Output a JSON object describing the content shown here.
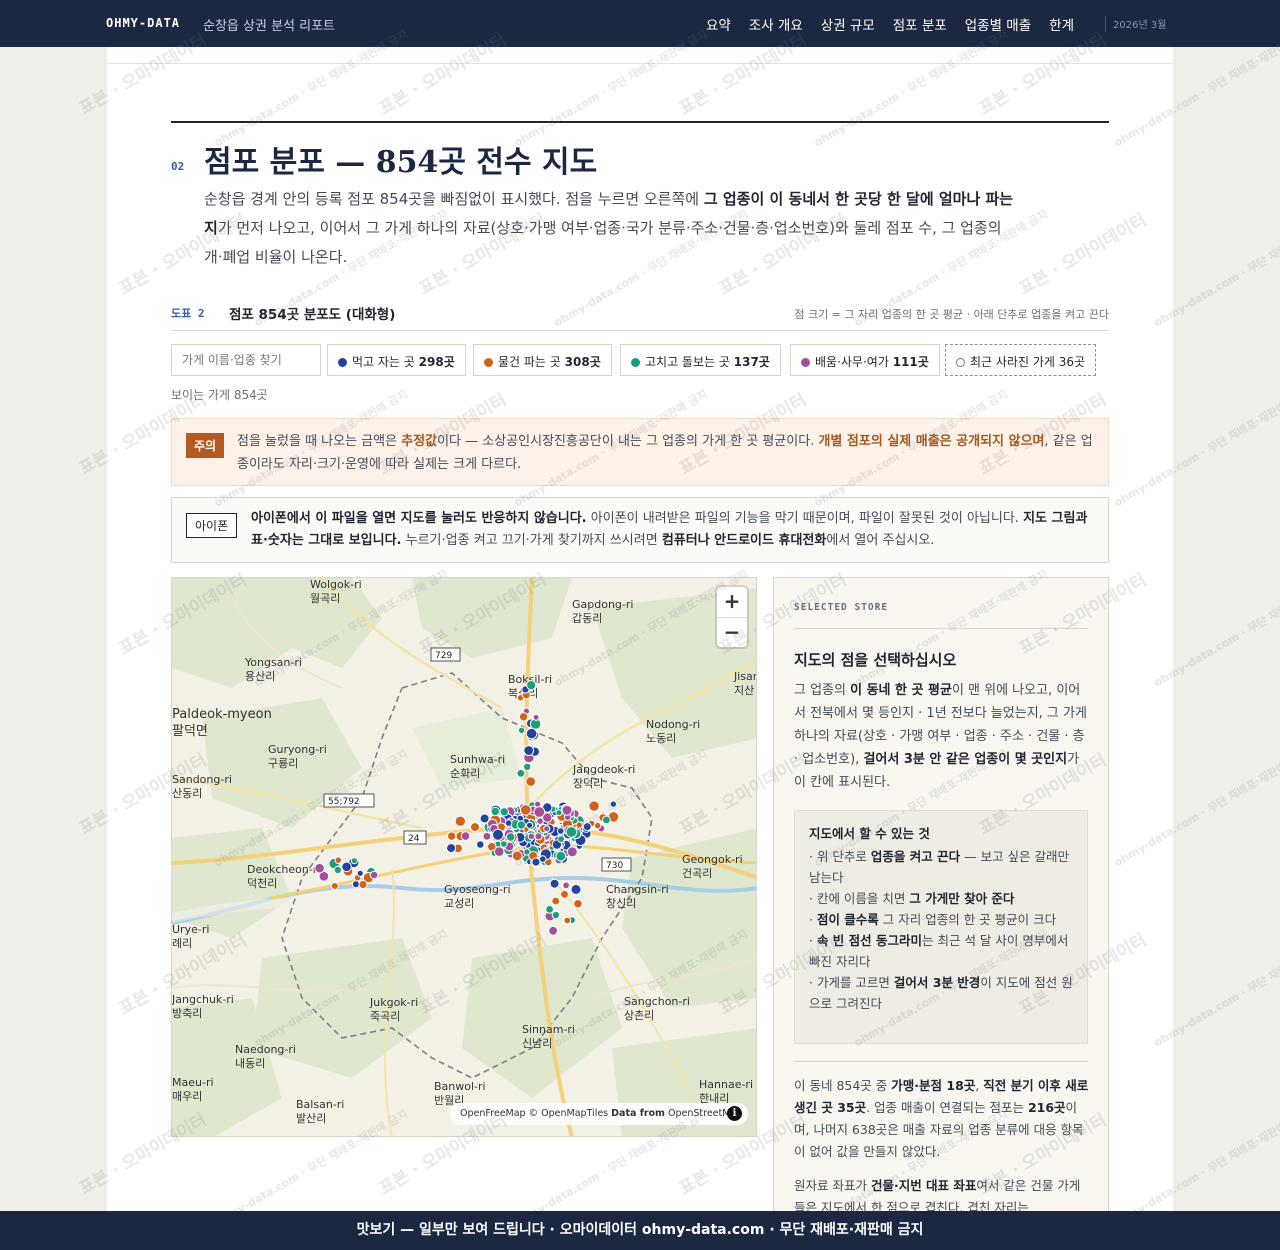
{
  "nav": {
    "brand": "OHMY-DATA",
    "report_title": "순창읍 상권 분석 리포트",
    "links": [
      "요약",
      "조사 개요",
      "상권 규모",
      "점포 분포",
      "업종별 매출",
      "한계"
    ],
    "date": "2026년 3월"
  },
  "section": {
    "number": "02",
    "title": "점포 분포 — 854곳 전수 지도",
    "lede_1": "순창읍 경계 안의 등록 점포 854곳을 빠짐없이 표시했다. 점을 누르면 오른쪽에 ",
    "lede_bold": "그 업종이 이 동네서 한 곳당 한 달에 얼마나 파는지",
    "lede_2": "가 먼저 나오고, 이어서 그 가게 하나의 자료(상호·가맹 여부·업종·국가 분류·주소·건물·층·업소번호)와 둘레 점포 수, 그 업종의 개·폐업 비율이 나온다."
  },
  "figure": {
    "label": "도표 2",
    "title": "점포 854곳 분포도 (대화형)",
    "note": "점 크기 = 그 자리 업종의 한 곳 평균 · 아래 단추로 업종을 켜고 끈다"
  },
  "filters": {
    "search_placeholder": "가게 이름·업종 찾기",
    "chips": [
      {
        "label": "먹고 자는 곳",
        "count": "298곳",
        "color": "#23439b"
      },
      {
        "label": "물건 파는 곳",
        "count": "308곳",
        "color": "#d0621a"
      },
      {
        "label": "고치고 돌보는 곳",
        "count": "137곳",
        "color": "#17a07a"
      },
      {
        "label": "배움·사무·여가",
        "count": "111곳",
        "color": "#a44f9a"
      },
      {
        "label": "최근 사라진 가게",
        "count": "36곳"
      }
    ],
    "visible_count": "보이는 가게 854곳"
  },
  "warning": {
    "badge": "주의",
    "text_1": "점을 눌렀을 때 나오는 금액은 ",
    "bold_1": "추정값",
    "text_2": "이다 — 소상공인시장진흥공단이 내는 그 업종의 가게 한 곳 평균이다. ",
    "bold_2": "개별 점포의 실제 매출은 공개되지 않으며",
    "text_3": ", 같은 업종이라도 자리·크기·운영에 따라 실제는 크게 다르다."
  },
  "ios": {
    "badge": "아이폰",
    "bold_1": "아이폰에서 이 파일을 열면 지도를 눌러도 반응하지 않습니다.",
    "text_1": " 아이폰이 내려받은 파일의 기능을 막기 때문이며, 파일이 잘못된 것이 아닙니다. ",
    "bold_2": "지도 그림과 표·숫자는 그대로 보입니다.",
    "text_2": " 누르기·업종 켜고 끄기·가게 찾기까지 쓰시려면 ",
    "bold_3": "컴퓨터나 안드로이드 휴대전화",
    "text_3": "에서 열어 주십시오."
  },
  "map": {
    "zoom_in": "+",
    "zoom_out": "−",
    "attribution_1": "OpenFreeMap © OpenMapTiles ",
    "attribution_bold": "Data from",
    "attribution_2": " OpenStreetMap",
    "info": "i",
    "places": [
      {
        "en": "Wolgok-ri",
        "ko": "월곡리"
      },
      {
        "en": "Gapdong-ri",
        "ko": "갑동리"
      },
      {
        "en": "Yongsan-ri",
        "ko": "용산리"
      },
      {
        "en": "Boksil-ri",
        "ko": "복실리"
      },
      {
        "en": "Paldeok-myeon",
        "ko": "팔덕면"
      },
      {
        "en": "Nodong-ri",
        "ko": "노동리"
      },
      {
        "en": "Guryong-ri",
        "ko": "구룡리"
      },
      {
        "en": "Sunhwa-ri",
        "ko": "순화리"
      },
      {
        "en": "Sandong-ri",
        "ko": "산동리"
      },
      {
        "en": "Jangdeok-ri",
        "ko": "장덕리"
      },
      {
        "en": "Deokcheon-ri",
        "ko": "덕천리"
      },
      {
        "en": "Geongok-ri",
        "ko": "건곡리"
      },
      {
        "en": "Gyoseong-ri",
        "ko": "교성리"
      },
      {
        "en": "Changsin-ri",
        "ko": "창신리"
      },
      {
        "en": "Jukgok-ri",
        "ko": "죽곡리"
      },
      {
        "en": "Sangchon-ri",
        "ko": "상촌리"
      },
      {
        "en": "Naedong-ri",
        "ko": "내동리"
      },
      {
        "en": "Sinnam-ri",
        "ko": "신남리"
      },
      {
        "en": "Maeu-ri",
        "ko": "매우리"
      },
      {
        "en": "Banwol-ri",
        "ko": "반월리"
      },
      {
        "en": "Hannae-ri",
        "ko": "한내리"
      },
      {
        "en": "Balsan-ri",
        "ko": "발산리"
      },
      {
        "en": "Jisan",
        "ko": "지산"
      },
      {
        "en": "Jangchuk-ri",
        "ko": "방축리"
      },
      {
        "en": "Urye-ri",
        "ko": "례리"
      }
    ],
    "roads": [
      "729",
      "55;792",
      "24",
      "730"
    ]
  },
  "panel": {
    "kicker": "SELECTED STORE",
    "title": "지도의 점을 선택하십시오",
    "desc_1": "그 업종의 ",
    "desc_bold_1": "이 동네 한 곳 평균",
    "desc_2": "이 맨 위에 나오고, 이어서 전북에서 몇 등인지 · 1년 전보다 늘었는지, 그 가게 하나의 자료(상호 · 가맹 여부 · 업종 · 주소 · 건물 · 층 · 업소번호), ",
    "desc_bold_2": "걸어서 3분 안 같은 업종이 몇 곳인지",
    "desc_3": "가 이 칸에 표시된다.",
    "tips_title": "지도에서 할 수 있는 것",
    "tip_1a": "· 위 단추로 ",
    "tip_1b": "업종을 켜고 끈다",
    "tip_1c": " — 보고 싶은 갈래만 남는다",
    "tip_2a": "· 칸에 이름을 치면 ",
    "tip_2b": "그 가게만 찾아 준다",
    "tip_3a": "· ",
    "tip_3b": "점이 클수록",
    "tip_3c": " 그 자리 업종의 한 곳 평균이 크다",
    "tip_4a": "· ",
    "tip_4b": "속 빈 점선 동그라미",
    "tip_4c": "는 최근 석 달 사이 명부에서 빠진 자리다",
    "tip_5a": "· 가게를 고르면 ",
    "tip_5b": "걸어서 3분 반경",
    "tip_5c": "이 지도에 점선 원으로 그려진다",
    "stats_1": "이 동네 854곳 중 ",
    "stats_bold_1": "가맹·분점 18곳",
    "stats_2": ", ",
    "stats_bold_2": "직전 분기 이후 새로 생긴 곳 35곳",
    "stats_3": ". 업종 매출이 연결되는 점포는 ",
    "stats_bold_3": "216곳",
    "stats_4": "이며, 나머지 638곳은 매출 자료의 업종 분류에 대응 항목이 없어 값을 만들지 않았다.",
    "note_1": "원자료 좌표가 ",
    "note_bold": "건물·지번 대표 좌표",
    "note_2": "여서 같은 건물 가게들은 지도에서 한 점으로 겹친다. 겹친 자리는"
  },
  "watermark": {
    "text": "표본 · 오마이데이터",
    "small": "ohmy-data.com · 무단 재배포·재판매 금지"
  },
  "bottom": "맛보기 — 일부만 보여 드립니다 · 오마이데이터 ohmy-data.com · 무단 재배포·재판매 금지",
  "colors": {
    "navy": "#1c2742",
    "eat": "#23439b",
    "shop": "#d0621a",
    "care": "#17a07a",
    "edu": "#a44f9a",
    "warn": "#b35a20"
  }
}
